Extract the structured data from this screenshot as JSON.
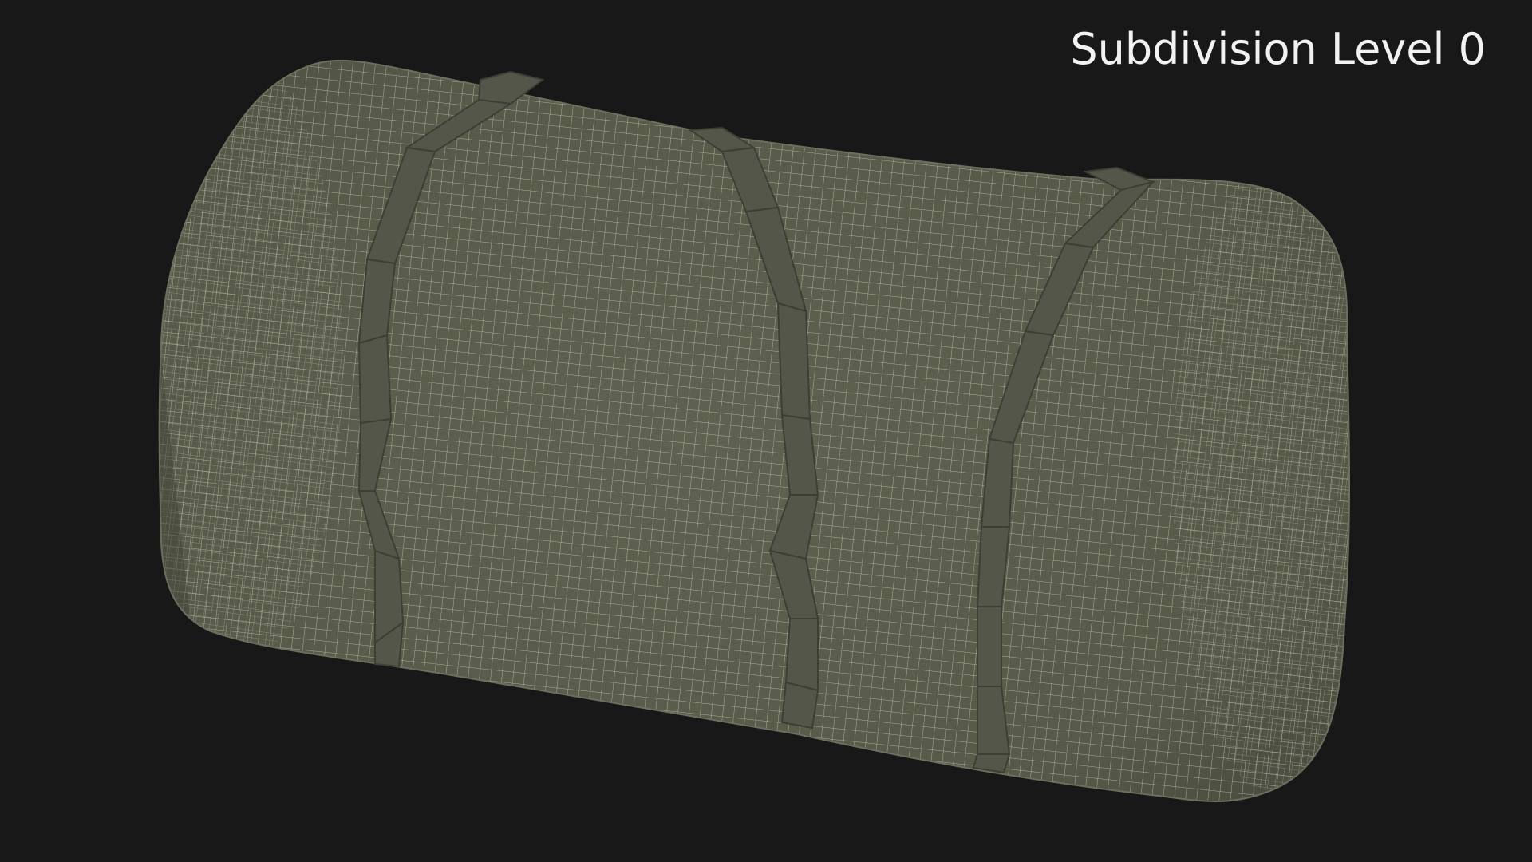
{
  "viewport": {
    "subdivision_label": "Subdivision Level 0",
    "background_color": "#181818",
    "mesh_fill_color": "#5b5d4d",
    "mesh_line_color": "#c9c8b4",
    "strap_color": "#54564a",
    "strap_line_color": "#3d3f35"
  },
  "model": {
    "icon": "duffel-bag-wireframe",
    "strap_count": 3
  }
}
